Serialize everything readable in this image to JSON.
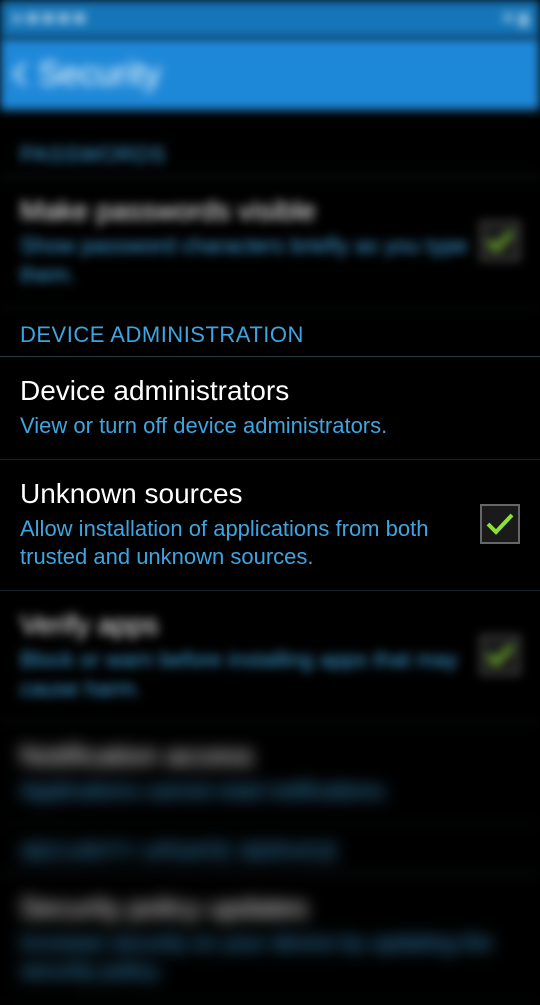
{
  "header": {
    "title": "Security"
  },
  "sections": {
    "passwords": {
      "label": "PASSWORDS",
      "make_visible": {
        "title": "Make passwords visible",
        "subtitle": "Show password characters briefly as you type them.",
        "checked": true
      }
    },
    "device_admin": {
      "label": "DEVICE ADMINISTRATION",
      "administrators": {
        "title": "Device administrators",
        "subtitle": "View or turn off device administrators."
      },
      "unknown_sources": {
        "title": "Unknown sources",
        "subtitle": "Allow installation of applications from both trusted and unknown sources.",
        "checked": true
      },
      "verify_apps": {
        "title": "Verify apps",
        "subtitle": "Block or warn before installing apps that may cause harm.",
        "checked": true
      },
      "notification_access": {
        "title": "Notification access",
        "subtitle": "Applications cannot read notifications."
      }
    },
    "security_update": {
      "label": "SECURITY UPDATE SERVICE",
      "policy_updates": {
        "title": "Security policy updates",
        "subtitle": "Increase security on your device by updating the security policy."
      }
    }
  }
}
